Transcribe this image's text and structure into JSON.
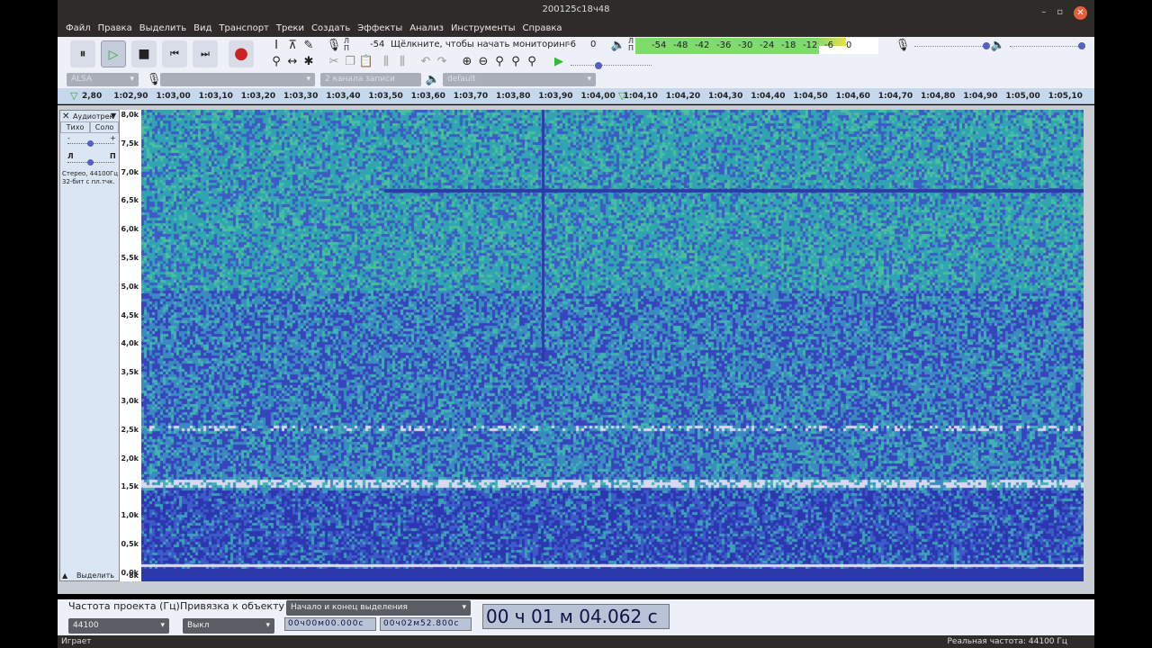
{
  "window": {
    "title": "200125с18ч48"
  },
  "menu": [
    "Файл",
    "Правка",
    "Выделить",
    "Вид",
    "Транспорт",
    "Треки",
    "Создать",
    "Эффекты",
    "Анализ",
    "Инструменты",
    "Справка"
  ],
  "transport": {
    "pause": "⏸",
    "play": "▷",
    "stop": "■",
    "skip_start": "⏮",
    "skip_end": "⏭",
    "record": "●"
  },
  "record_meter": {
    "lr": "Л\nП",
    "minus54": "-54",
    "hint": "Щёлкните, чтобы начать мониторинг",
    "minus6": "-6",
    "zero": "0"
  },
  "playback_meter": {
    "lr": "Л\nП",
    "ticks": [
      "-54",
      "-48",
      "-42",
      "-36",
      "-30",
      "-24",
      "-18",
      "-12",
      "-6",
      "0"
    ],
    "level_left_db": -6,
    "level_right_db": -13,
    "green": "#7edc6a",
    "yellow": "#e8e040"
  },
  "devices": {
    "host": "ALSA",
    "input_device": "",
    "channels": "2 канала записи (стерео)",
    "output_device": "default"
  },
  "ruler": {
    "labels": [
      "2,80",
      "1:02,90",
      "1:03,00",
      "1:03,10",
      "1:03,20",
      "1:03,30",
      "1:03,40",
      "1:03,50",
      "1:03,60",
      "1:03,70",
      "1:03,80",
      "1:03,90",
      "1:04,00",
      "1:04,10",
      "1:04,20",
      "1:04,30",
      "1:04,40",
      "1:04,50",
      "1:04,60",
      "1:04,70",
      "1:04,80",
      "1:04,90",
      "1:05,00",
      "1:05,10"
    ]
  },
  "track": {
    "name": "Аудиотрек",
    "mute": "Тихо",
    "solo": "Соло",
    "gain_minus": "-",
    "gain_plus": "+",
    "pan_left": "Л",
    "pan_right": "П",
    "info1": "Стерео, 44100Гц",
    "info2": "32-бит с пл.тчк.",
    "select": "Выделить",
    "gain": 0.5,
    "pan": 0.5
  },
  "freq_axis": [
    "8,0k",
    "7,5k",
    "7,0k",
    "6,5k",
    "6,0k",
    "5,5k",
    "5,0k",
    "4,5k",
    "4,0k",
    "3,5k",
    "3,0k",
    "2,5k",
    "2,0k",
    "1,5k",
    "1,0k",
    "0,5k",
    "0,0k"
  ],
  "freq_bottom": "8k",
  "bottom": {
    "rate_label": "Частота проекта (Гц)",
    "rate_value": "44100",
    "snap_label": "Привязка к объекту",
    "snap_value": "Выкл",
    "selection_mode": "Начало и конец выделения",
    "sel_start": "00ч00м00.000с",
    "sel_end": "00ч02м52.800с",
    "time": "00 ч 01 м 04.062 с"
  },
  "status": {
    "left": "Играет",
    "right": "Реальная частота: 44100 Гц"
  }
}
